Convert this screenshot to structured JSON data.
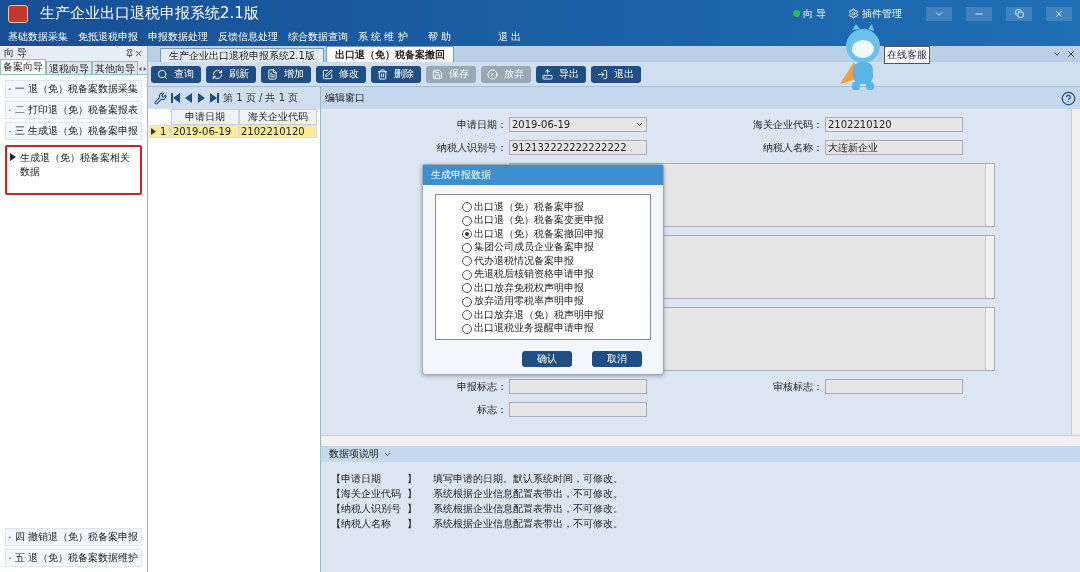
{
  "window": {
    "title": "生产企业出口退税申报系统2.1版"
  },
  "top_links": [
    {
      "kind": "status",
      "label": "向 导"
    },
    {
      "kind": "gear",
      "label": "插件管理"
    }
  ],
  "menu": [
    "基础数据采集",
    "免抵退税申报",
    "申报数据处理",
    "反馈信息处理",
    "综合数据查询",
    "系 统 维 护",
    "帮 助",
    "退 出"
  ],
  "mascot": {
    "label": "在线客服"
  },
  "nav": {
    "title": "向 导",
    "tabs": [
      {
        "label": "备案向导",
        "selected": true
      },
      {
        "label": "退税向导",
        "selected": false
      },
      {
        "label": "其他向导",
        "selected": false
      }
    ],
    "items": [
      {
        "number": "一",
        "label": "退（免）税备案数据采集",
        "expanded": false
      },
      {
        "number": "二",
        "label": "打印退（免）税备案报表",
        "expanded": false
      },
      {
        "number": "三",
        "label": "生成退（免）税备案申报",
        "expanded": true,
        "children": [
          {
            "label": "生成退（免）税备案相关数据",
            "highlighted": true
          }
        ]
      }
    ],
    "bottom_items": [
      {
        "number": "四",
        "label": "撤销退（免）税备案申报",
        "expanded": false
      },
      {
        "number": "五",
        "label": "退（免）税备案数据维护",
        "expanded": false
      }
    ]
  },
  "doc_tabs": [
    {
      "label": "生产企业出口退税申报系统2.1版",
      "selected": false
    },
    {
      "label": "出口退（免）税备案撤回",
      "selected": true
    }
  ],
  "toolbar": [
    {
      "kind": "search",
      "label": "查询",
      "disabled": false
    },
    {
      "kind": "refresh",
      "label": "刷新",
      "disabled": false
    },
    {
      "kind": "add",
      "label": "增加",
      "disabled": false
    },
    {
      "kind": "edit",
      "label": "修改",
      "disabled": false
    },
    {
      "kind": "delete",
      "label": "删除",
      "disabled": false
    },
    {
      "kind": "save",
      "label": "保存",
      "disabled": true
    },
    {
      "kind": "cancel",
      "label": "放弃",
      "disabled": true
    },
    {
      "kind": "export",
      "label": "导出",
      "disabled": false
    },
    {
      "kind": "exit",
      "label": "退出",
      "disabled": false
    }
  ],
  "pager": {
    "text": "第 1 页 / 共 1 页"
  },
  "list": {
    "columns": [
      "申请日期",
      "海关企业代码"
    ],
    "rows": [
      {
        "number": "1",
        "cells": [
          "2019-06-19",
          "2102210120"
        ],
        "selected": true
      }
    ]
  },
  "editor": {
    "title": "编辑窗口",
    "rows": [
      {
        "kind": "pair",
        "fields": [
          {
            "label": "申请日期：",
            "value": "2019-06-19",
            "kind": "select"
          },
          {
            "label": "海关企业代码：",
            "value": "2102210120",
            "kind": "text"
          }
        ]
      },
      {
        "kind": "pair",
        "fields": [
          {
            "label": "纳税人识别号：",
            "value": "912132222222222222",
            "kind": "text"
          },
          {
            "label": "纳税人名称：",
            "value": "大连新企业",
            "kind": "text"
          }
        ]
      },
      {
        "kind": "textarea"
      },
      {
        "kind": "textarea"
      },
      {
        "kind": "textarea"
      },
      {
        "kind": "pair",
        "fields": [
          {
            "label": "申报标志：",
            "kind": "text"
          },
          {
            "label": "审核标志：",
            "kind": "text"
          }
        ]
      },
      {
        "kind": "pair",
        "fields": [
          {
            "label": "标志：",
            "kind": "text"
          }
        ]
      }
    ]
  },
  "dialog": {
    "title": "生成申报数据",
    "options": [
      {
        "label": "出口退（免）税备案申报",
        "selected": false
      },
      {
        "label": "出口退（免）税备案变更申报",
        "selected": false
      },
      {
        "label": "出口退（免）税备案撤回申报",
        "selected": true
      },
      {
        "label": "集团公司成员企业备案申报",
        "selected": false
      },
      {
        "label": "代办退税情况备案申报",
        "selected": false
      },
      {
        "label": "先退税后核销资格申请申报",
        "selected": false
      },
      {
        "label": "出口放弃免税权声明申报",
        "selected": false
      },
      {
        "label": "放弃适用零税率声明申报",
        "selected": false
      },
      {
        "label": "出口放弃退（免）税声明申报",
        "selected": false
      },
      {
        "label": "出口退税业务提醒申请申报",
        "selected": false
      }
    ],
    "buttons": [
      "确认",
      "取消"
    ]
  },
  "help": {
    "title": "数据项说明",
    "rows": [
      {
        "item": "【申请日期",
        "close": "】",
        "text": "填写申请的日期。默认系统时间，可修改。"
      },
      {
        "item": "【海关企业代码",
        "close": "】",
        "text": "系统根据企业信息配置表带出，不可修改。"
      },
      {
        "item": "【纳税人识别号",
        "close": "】",
        "text": "系统根据企业信息配置表带出，不可修改。"
      },
      {
        "item": "【纳税人名称",
        "close": "】",
        "text": "系统根据企业信息配置表带出，不可修改。"
      }
    ]
  }
}
